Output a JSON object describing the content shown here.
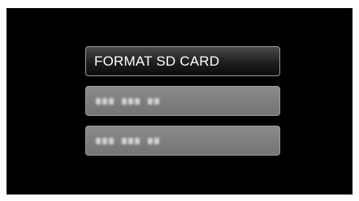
{
  "menu": {
    "items": [
      {
        "label": "FORMAT SD CARD",
        "state": "selected"
      },
      {
        "label": "",
        "state": "disabled"
      },
      {
        "label": "",
        "state": "disabled"
      }
    ]
  },
  "colors": {
    "screen_background": "#000000",
    "selected_item": "#1e1e1e",
    "disabled_item": "#7a7a7a",
    "text": "#ffffff"
  }
}
